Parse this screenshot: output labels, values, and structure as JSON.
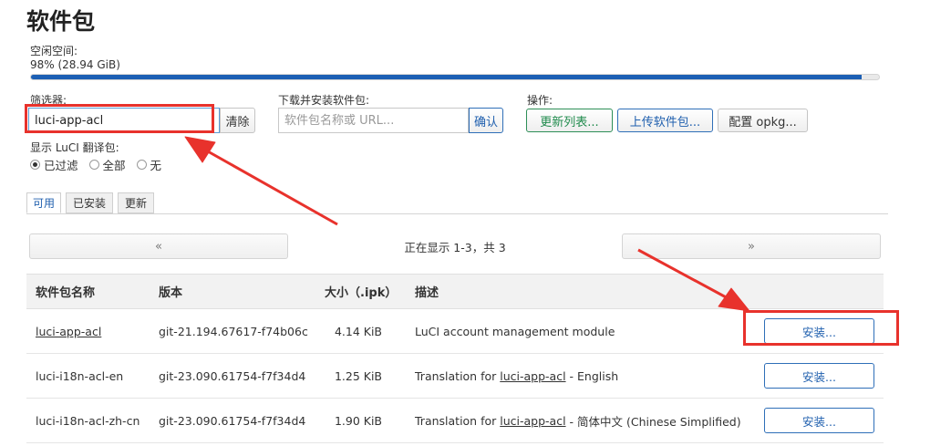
{
  "page": {
    "title": "软件包"
  },
  "free_space": {
    "label": "空闲空间:",
    "value_text": "98% (28.94 GiB)",
    "percent": 98
  },
  "filter": {
    "label": "筛选器:",
    "value": "luci-app-acl",
    "clear_label": "清除"
  },
  "download": {
    "label": "下载并安装软件包:",
    "placeholder": "软件包名称或 URL...",
    "confirm_label": "确认"
  },
  "actions": {
    "label": "操作:",
    "update_label": "更新列表...",
    "upload_label": "上传软件包...",
    "configure_label": "配置 opkg..."
  },
  "translations": {
    "label": "显示 LuCI 翻译包:",
    "options": [
      {
        "label": "已过滤",
        "checked": true
      },
      {
        "label": "全部",
        "checked": false
      },
      {
        "label": "无",
        "checked": false
      }
    ]
  },
  "tabs": [
    {
      "label": "可用",
      "active": true
    },
    {
      "label": "已安装",
      "active": false
    },
    {
      "label": "更新",
      "active": false
    }
  ],
  "pager": {
    "prev": "«",
    "next": "»",
    "status": "正在显示 1-3，共 3"
  },
  "table": {
    "headers": {
      "name": "软件包名称",
      "version": "版本",
      "size": "大小（.ipk）",
      "description": "描述"
    },
    "rows": [
      {
        "name": "luci-app-acl",
        "version": "git-21.194.67617-f74b06c",
        "size": "4.14 KiB",
        "desc_prefix": "LuCI account management module",
        "desc_link": "",
        "desc_suffix": "",
        "install_label": "安装..."
      },
      {
        "name": "luci-i18n-acl-en",
        "version": "git-23.090.61754-f7f34d4",
        "size": "1.25 KiB",
        "desc_prefix": "Translation for ",
        "desc_link": "luci-app-acl",
        "desc_suffix": " - English",
        "install_label": "安装..."
      },
      {
        "name": "luci-i18n-acl-zh-cn",
        "version": "git-23.090.61754-f7f34d4",
        "size": "1.90 KiB",
        "desc_prefix": "Translation for ",
        "desc_link": "luci-app-acl",
        "desc_suffix": " - 简体中文 (Chinese Simplified)",
        "install_label": "安装..."
      }
    ]
  },
  "colors": {
    "annotation": "#e8322c",
    "accent": "#1c5fb4"
  }
}
